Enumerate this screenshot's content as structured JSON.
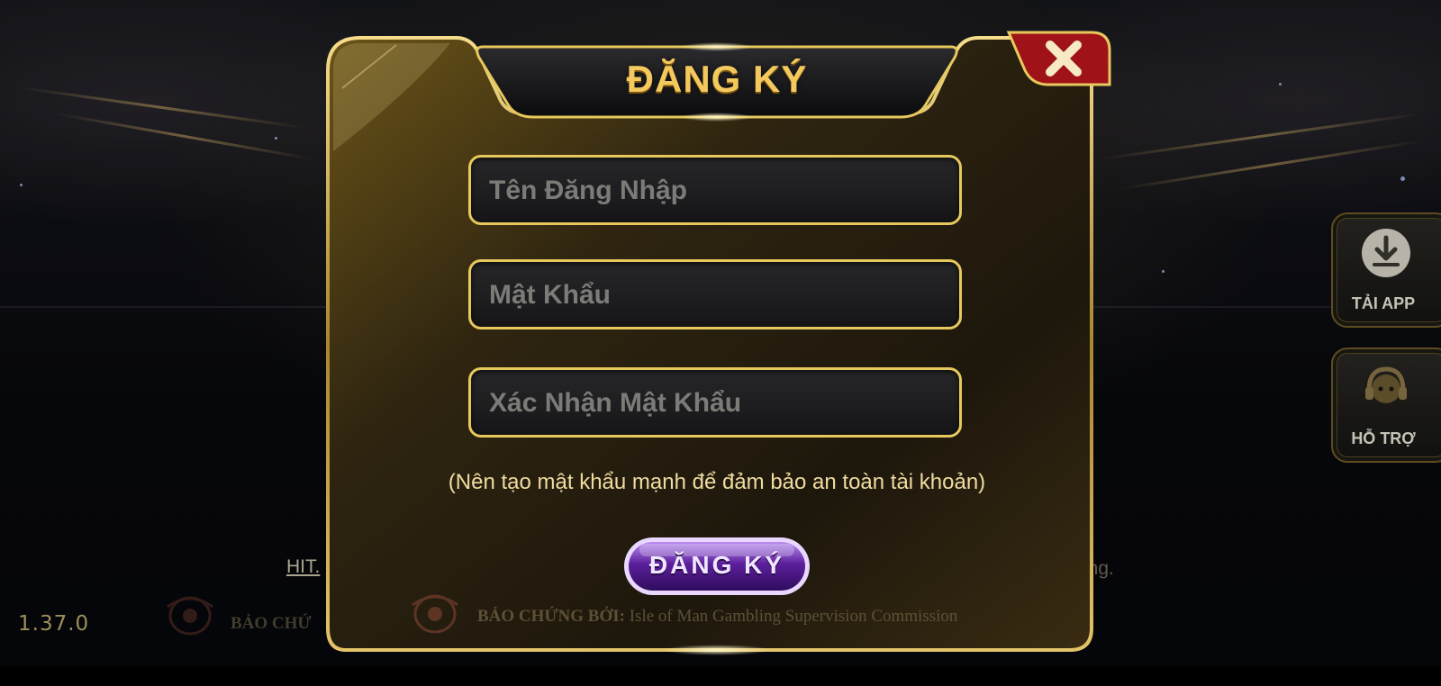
{
  "dialog": {
    "title": "ĐĂNG KÝ",
    "close_icon": "close-icon",
    "fields": {
      "username_placeholder": "Tên Đăng Nhập",
      "password_placeholder": "Mật Khẩu",
      "confirm_placeholder": "Xác Nhận Mật Khẩu"
    },
    "hint": "(Nên tạo mật khẩu mạnh để đảm bảo an toàn tài khoản)",
    "submit_label": "ĐĂNG KÝ",
    "certified_by_label": "BẢO CHỨNG BỞI:",
    "certified_by_value": " Isle of Man Gambling Supervision Commission"
  },
  "background": {
    "hit_link": "HIT.",
    "tail_text": "ăng.",
    "version": "1.37.0",
    "bao_label": "BẢO CHỨ"
  },
  "side": {
    "download_label": "TẢI APP",
    "download_icon": "download-icon",
    "support_label": "HỖ TRỢ",
    "support_icon": "headset-icon"
  },
  "colors": {
    "gold": "#e6c85c",
    "title_gold": "#f3c95e",
    "close_red": "#a3141a",
    "submit_purple": "#7b2fc0"
  }
}
